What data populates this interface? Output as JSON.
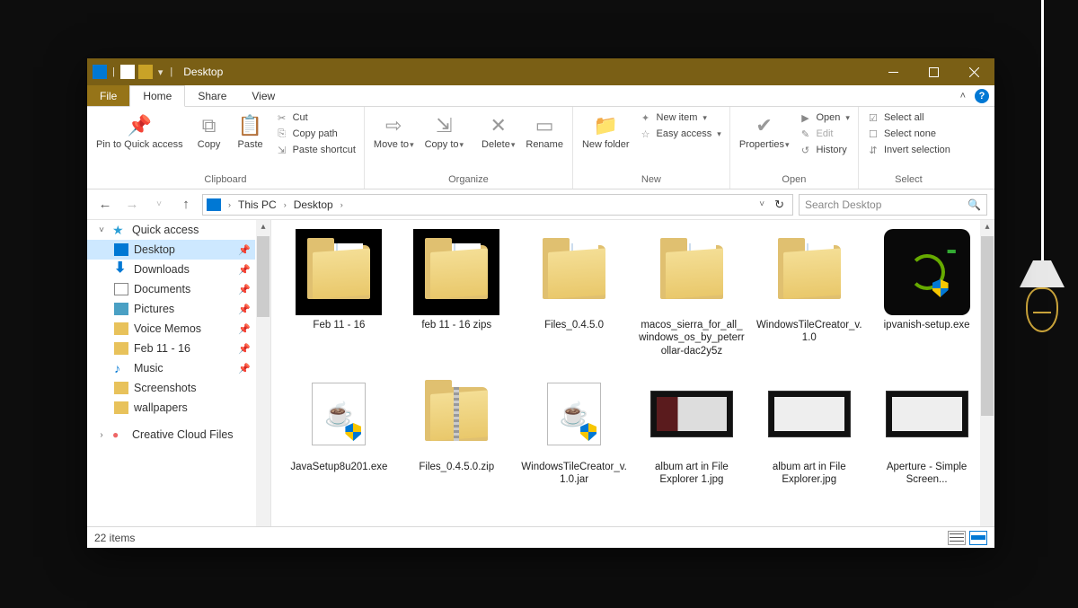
{
  "titlebar": {
    "title": "Desktop"
  },
  "tabs": {
    "file": "File",
    "home": "Home",
    "share": "Share",
    "view": "View"
  },
  "ribbon": {
    "clipboard": {
      "label": "Clipboard",
      "pin": "Pin to Quick access",
      "copy": "Copy",
      "paste": "Paste",
      "cut": "Cut",
      "copy_path": "Copy path",
      "paste_shortcut": "Paste shortcut"
    },
    "organize": {
      "label": "Organize",
      "move_to": "Move to",
      "copy_to": "Copy to",
      "delete": "Delete",
      "rename": "Rename"
    },
    "new": {
      "label": "New",
      "new_folder": "New folder",
      "new_item": "New item",
      "easy_access": "Easy access"
    },
    "open": {
      "label": "Open",
      "properties": "Properties",
      "open": "Open",
      "edit": "Edit",
      "history": "History"
    },
    "select": {
      "label": "Select",
      "select_all": "Select all",
      "select_none": "Select none",
      "invert": "Invert selection"
    }
  },
  "breadcrumbs": {
    "root": "This PC",
    "leaf": "Desktop"
  },
  "search": {
    "placeholder": "Search Desktop"
  },
  "sidebar": {
    "quick_access": "Quick access",
    "items": [
      {
        "label": "Desktop",
        "icon": "monitor",
        "pinned": true,
        "selected": true
      },
      {
        "label": "Downloads",
        "icon": "down",
        "pinned": true
      },
      {
        "label": "Documents",
        "icon": "doc",
        "pinned": true
      },
      {
        "label": "Pictures",
        "icon": "pic",
        "pinned": true
      },
      {
        "label": "Voice Memos",
        "icon": "fld",
        "pinned": true
      },
      {
        "label": "Feb 11 - 16",
        "icon": "fld",
        "pinned": true
      },
      {
        "label": "Music",
        "icon": "music",
        "pinned": true
      },
      {
        "label": "Screenshots",
        "icon": "fld"
      },
      {
        "label": "wallpapers",
        "icon": "fld"
      }
    ],
    "cloud": "Creative Cloud Files"
  },
  "items": [
    {
      "name": "Feb 11 - 16",
      "type": "folder-black"
    },
    {
      "name": "feb 11 - 16 zips",
      "type": "folder-black"
    },
    {
      "name": "Files_0.4.5.0",
      "type": "folder"
    },
    {
      "name": "macos_sierra_for_all_windows_os_by_peterrollar-dac2y5z",
      "type": "folder"
    },
    {
      "name": "WindowsTileCreator_v.1.0",
      "type": "folder"
    },
    {
      "name": "ipvanish-setup.exe",
      "type": "ipvanish"
    },
    {
      "name": "JavaSetup8u201.exe",
      "type": "java-exe"
    },
    {
      "name": "Files_0.4.5.0.zip",
      "type": "zip"
    },
    {
      "name": "WindowsTileCreator_v.1.0.jar",
      "type": "jar"
    },
    {
      "name": "album art in File Explorer 1.jpg",
      "type": "screenshot-red"
    },
    {
      "name": "album art in File Explorer.jpg",
      "type": "screenshot"
    },
    {
      "name": "Aperture - Simple Screen...",
      "type": "screenshot"
    }
  ],
  "status": {
    "count": "22 items"
  }
}
